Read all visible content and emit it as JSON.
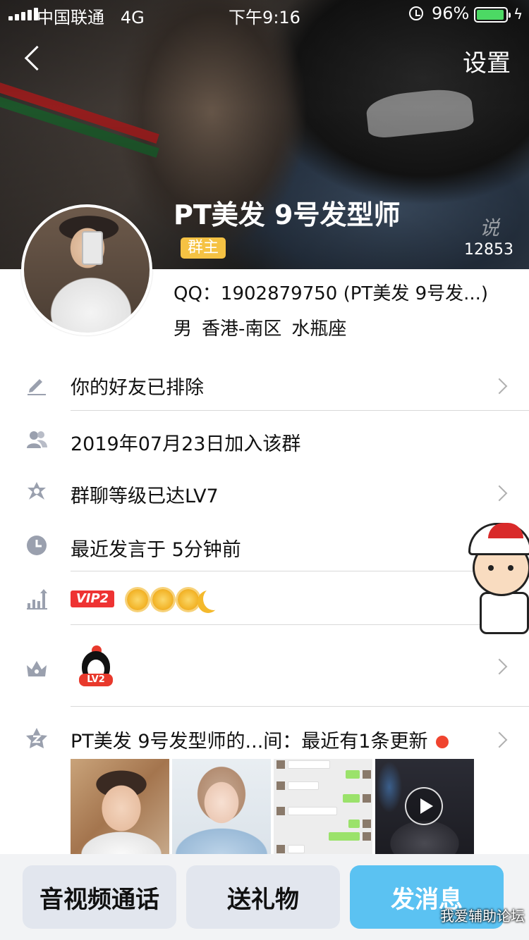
{
  "status_bar": {
    "carrier": "中国联通",
    "network": "4G",
    "time": "下午9:16",
    "battery_percent": "96%",
    "battery_level": 0.96
  },
  "header": {
    "settings_label": "设置",
    "name": "PT美发  9号发型师",
    "role_badge": "群主",
    "like_count": "12853",
    "cover_mark": "说"
  },
  "info": {
    "qq_line": "QQ：1902879750 (PT美发  9号发...)",
    "gender": "男",
    "location": "香港-南区",
    "zodiac": "水瓶座"
  },
  "rows": {
    "friend_status": "你的好友已排除",
    "join_date": "2019年07月23日加入该群",
    "group_level": "群聊等级已达LV7",
    "last_speak": "最近发言于 5分钟前",
    "vip_badge": "VIP2",
    "penguin_level": "LV2",
    "space_update": "PT美发  9号发型师的...间：最近有1条更新"
  },
  "icons": {
    "edit": "pencil-icon",
    "members": "people-icon",
    "level": "star-icon",
    "recent": "clock-icon",
    "growth": "bar-chart-icon",
    "crown": "crown-icon",
    "space": "qzone-icon"
  },
  "bottom": {
    "call_label": "音视频通话",
    "gift_label": "送礼物",
    "message_label": "发消息",
    "site_watermark": "我爱辅助论坛"
  },
  "colors": {
    "accent_blue": "#5bc2f2",
    "badge_yellow": "#f5c243",
    "vip_red": "#e33333",
    "update_dot": "#f0442f"
  }
}
